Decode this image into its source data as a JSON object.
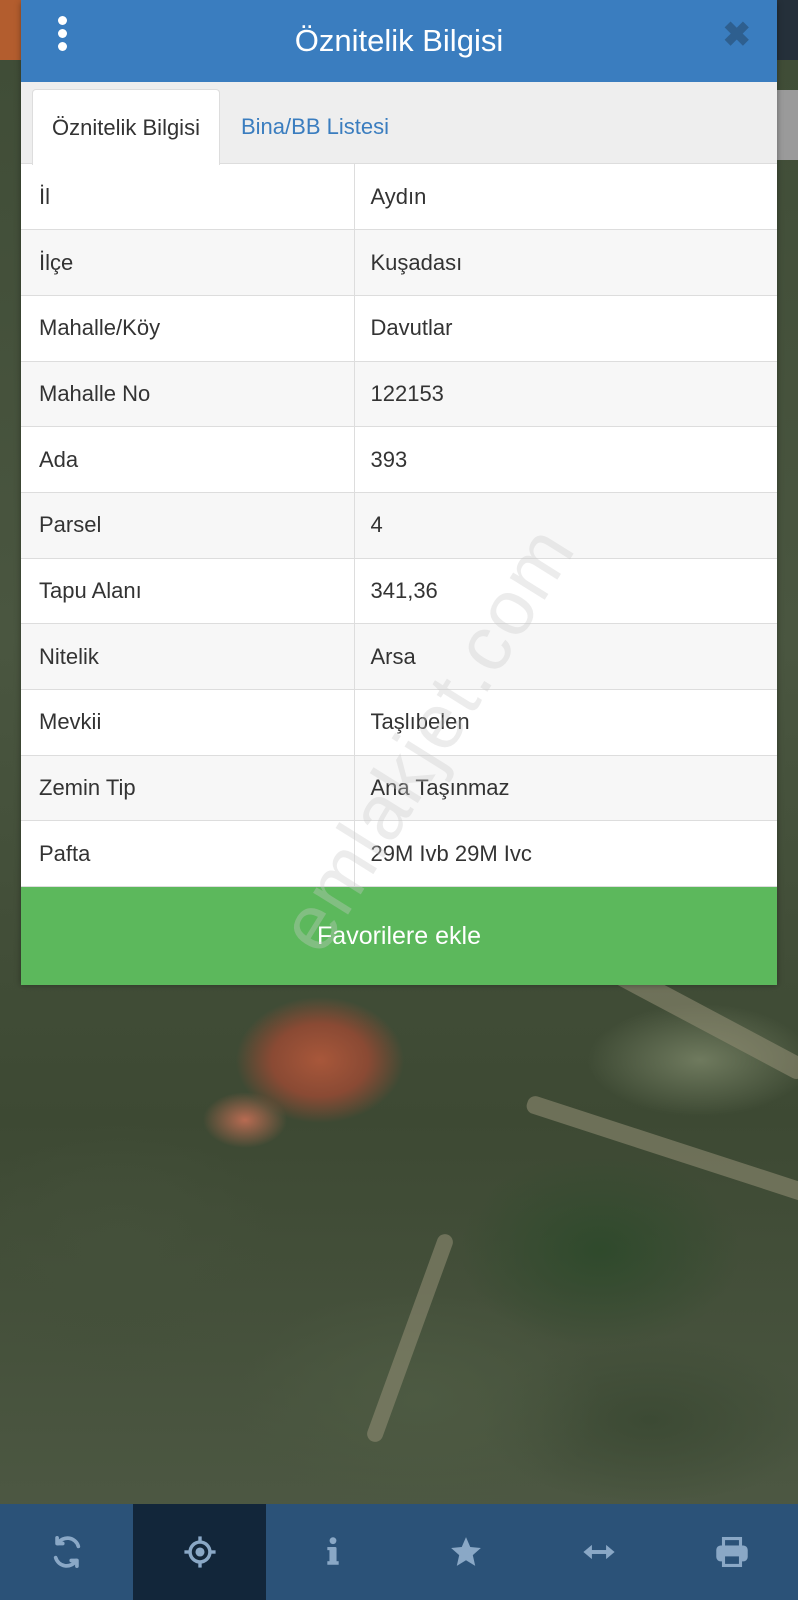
{
  "header": {
    "title": "Öznitelik Bilgisi",
    "menu_icon": "more-vertical-icon",
    "close_icon": "close-icon"
  },
  "tabs": [
    {
      "label": "Öznitelik Bilgisi",
      "active": true
    },
    {
      "label": "Bina/BB Listesi",
      "active": false
    }
  ],
  "attributes": [
    {
      "key": "İl",
      "value": "Aydın"
    },
    {
      "key": "İlçe",
      "value": "Kuşadası"
    },
    {
      "key": "Mahalle/Köy",
      "value": "Davutlar"
    },
    {
      "key": "Mahalle No",
      "value": "122153"
    },
    {
      "key": "Ada",
      "value": "393"
    },
    {
      "key": "Parsel",
      "value": "4"
    },
    {
      "key": "Tapu Alanı",
      "value": "341,36"
    },
    {
      "key": "Nitelik",
      "value": "Arsa"
    },
    {
      "key": "Mevkii",
      "value": "Taşlıbelen"
    },
    {
      "key": "Zemin Tip",
      "value": "Ana Taşınmaz"
    },
    {
      "key": "Pafta",
      "value": "29M Ivb 29M Ivc"
    }
  ],
  "favorite_button": "Favorilere ekle",
  "watermark": "emlakjet.com",
  "toolbar": [
    {
      "icon": "refresh-icon",
      "active": false
    },
    {
      "icon": "locate-crosshair-icon",
      "active": true
    },
    {
      "icon": "info-icon",
      "active": false
    },
    {
      "icon": "star-icon",
      "active": false
    },
    {
      "icon": "measure-arrows-icon",
      "active": false
    },
    {
      "icon": "print-icon",
      "active": false
    }
  ],
  "colors": {
    "header": "#3a7dbf",
    "favorite": "#5cb85c",
    "toolbar": "#2b5278",
    "toolbar_active": "#12263a"
  }
}
